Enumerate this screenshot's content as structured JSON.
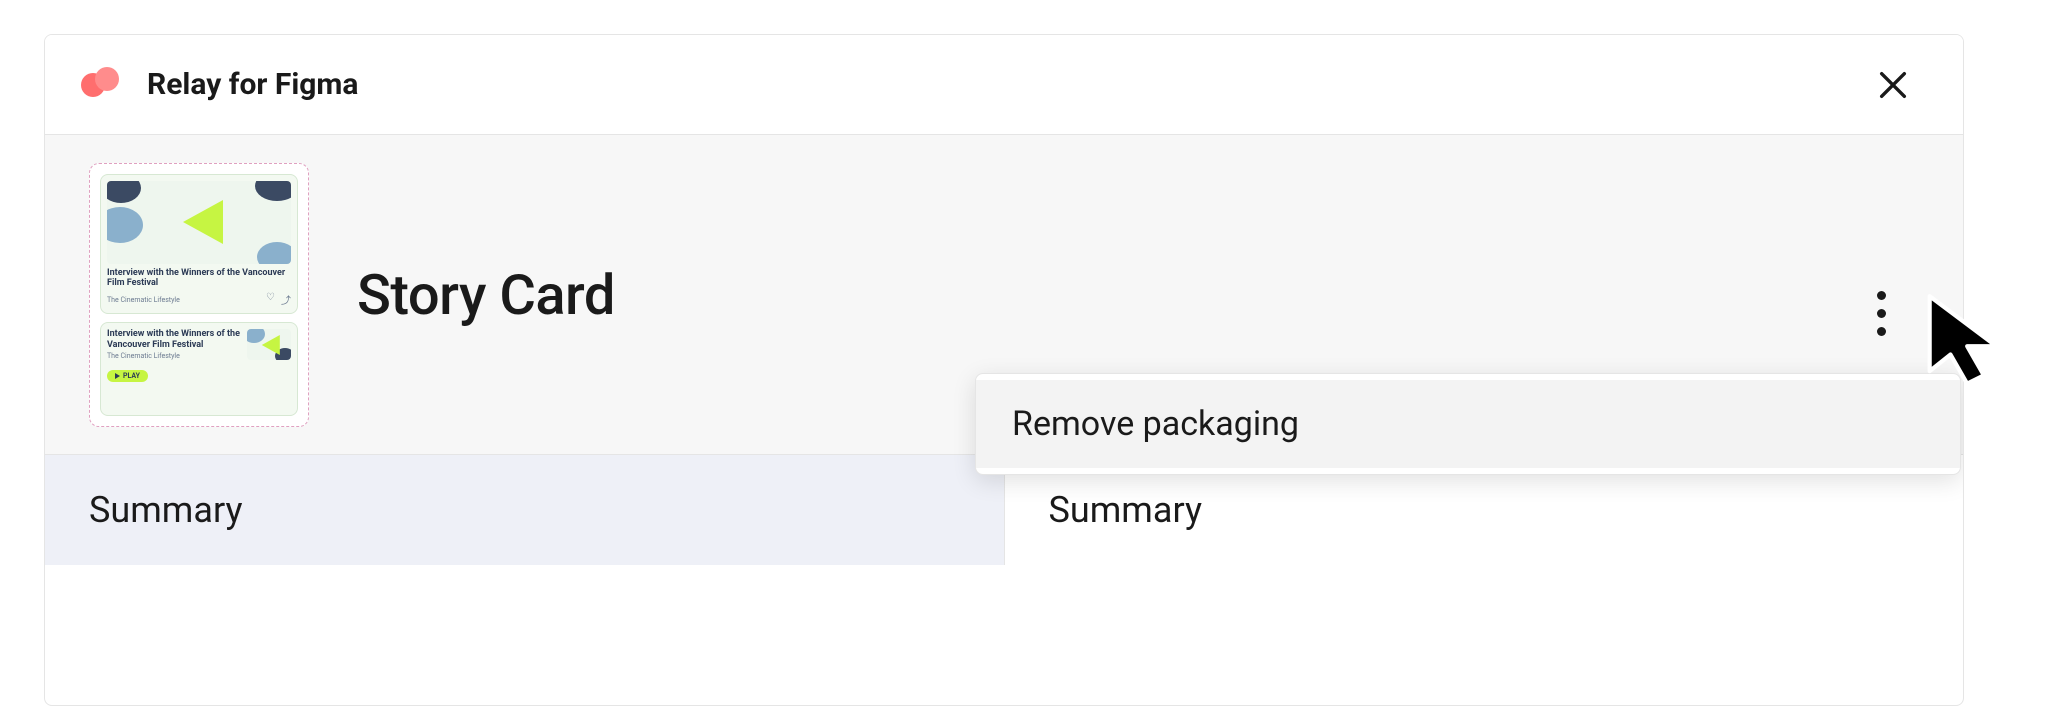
{
  "header": {
    "plugin_title": "Relay for Figma"
  },
  "component": {
    "title": "Story Card",
    "thumbnail": {
      "card_title": "Interview with the Winners of the Vancouver Film Festival",
      "card_subtitle": "The Cinematic Lifestyle",
      "play_label": "PLAY"
    }
  },
  "dropdown": {
    "items": [
      {
        "label": "Remove packaging"
      }
    ]
  },
  "tabs": {
    "left": "Summary",
    "right": "Summary"
  }
}
